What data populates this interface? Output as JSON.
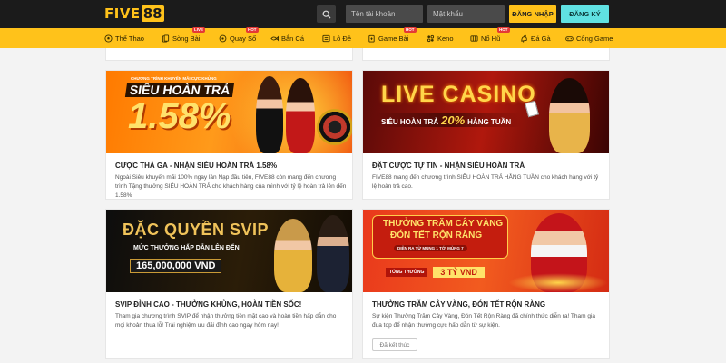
{
  "header": {
    "logo_part1": "FIVE",
    "logo_part2": "88",
    "username_placeholder": "Tên tài khoản",
    "password_placeholder": "Mật khẩu",
    "login_label": "ĐĂNG NHẬP",
    "register_label": "ĐĂNG KÝ"
  },
  "nav": {
    "items": [
      {
        "label": "Thể Thao",
        "icon": "soccer-ball-icon"
      },
      {
        "label": "Sòng Bài",
        "icon": "cards-icon",
        "badge": "LIVE"
      },
      {
        "label": "Quay Số",
        "icon": "lottery-icon",
        "badge": "HOT"
      },
      {
        "label": "Bắn Cá",
        "icon": "fish-icon"
      },
      {
        "label": "Lô Đề",
        "icon": "lotto-icon"
      },
      {
        "label": "Game Bài",
        "icon": "game-cards-icon",
        "badge": "HOT"
      },
      {
        "label": "Keno",
        "icon": "keno-icon"
      },
      {
        "label": "Nổ Hũ",
        "icon": "slot-icon",
        "badge": "HOT"
      },
      {
        "label": "Đá Gà",
        "icon": "rooster-icon"
      },
      {
        "label": "Cổng Game",
        "icon": "gamepad-icon"
      }
    ]
  },
  "promos": [
    {
      "banner_kicker": "CHƯƠNG TRÌNH KHUYẾN MÃI CỰC KHỦNG",
      "banner_title": "SIÊU HOÀN TRẢ",
      "banner_value": "1.58%",
      "title": "CƯỢC THẢ GA - NHẬN SIÊU HOÀN TRẢ 1.58%",
      "description": "Ngoài Siêu khuyến mãi 100% ngay lần Nạp đầu tiên, FIVE88 còn mang đến chương trình Tặng thưởng SIÊU HOÀN TRẢ cho khách hàng của mình với tỷ lệ hoàn trả lên đến 1.58%"
    },
    {
      "banner_title": "LIVE CASINO",
      "banner_sub": "SIÊU HOÀN TRẢ",
      "banner_value": "20%",
      "banner_tail": "HÀNG TUẦN",
      "title": "ĐẶT CƯỢC TỰ TIN - NHẬN SIÊU HOÀN TRẢ",
      "description": "FIVE88 mang đến chương trình SIÊU HOÀN TRẢ HẰNG TUẦN cho khách hàng với tỷ lệ hoàn trả cao."
    },
    {
      "banner_title": "ĐẶC QUYỀN SVIP",
      "banner_sub": "MỨC THƯỞNG HẤP DẪN LÊN ĐẾN",
      "banner_value": "165,000,000 VND",
      "title": "SVIP ĐỈNH CAO - THƯỞNG KHỦNG, HOÀN TIỀN SỐC!",
      "description": "Tham gia chương trình SVIP để nhận thưởng tiền mặt cao và hoàn tiền hấp dẫn cho mọi khoản thua lỗ! Trải nghiệm ưu đãi đỉnh cao ngay hôm nay!"
    },
    {
      "banner_title_1": "THƯỞNG TRĂM CÂY VÀNG",
      "banner_title_2": "ĐÓN TẾT RỘN RÀNG",
      "banner_dates": "DIỄN RA TỪ MÙNG 1 TỚI MÙNG 7",
      "banner_prize_label": "TỔNG THƯỞNG",
      "banner_prize_value": "3 TỶ VND",
      "title": "THƯỞNG TRĂM CÂY VÀNG, ĐÓN TẾT RỘN RÀNG",
      "description": "Sự kiện Thưởng Trăm Cây Vàng, Đón Tết Rộn Ràng đã chính thức diễn ra! Tham gia đua top để nhận thưởng cực hấp dẫn từ sự kiện.",
      "button": "Đã kết thúc"
    }
  ],
  "colors": {
    "header_bg": "#1b1b1b",
    "accent": "#ffc21a",
    "register": "#60e1e2"
  }
}
